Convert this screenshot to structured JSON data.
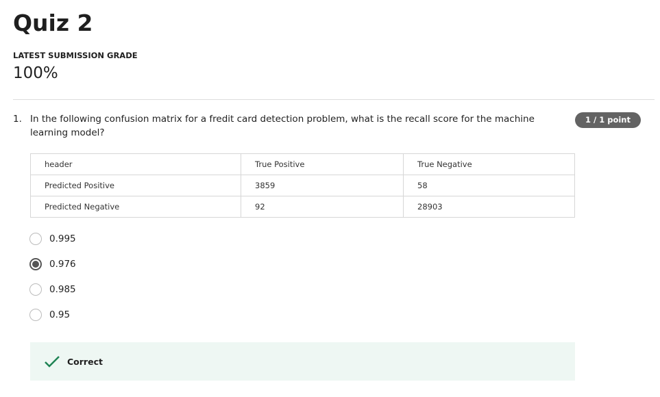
{
  "title": "Quiz 2",
  "grade_label": "LATEST SUBMISSION GRADE",
  "grade_value": "100%",
  "question": {
    "number": "1.",
    "text": "In the following confusion matrix for a fredit card detection problem, what is the recall score for the machine learning model?",
    "points": "1 / 1 point",
    "table": [
      [
        "header",
        "True Positive",
        "True Negative"
      ],
      [
        "Predicted Positive",
        "3859",
        "58"
      ],
      [
        "Predicted Negative",
        "92",
        "28903"
      ]
    ],
    "options": [
      {
        "label": "0.995",
        "selected": false
      },
      {
        "label": "0.976",
        "selected": true
      },
      {
        "label": "0.985",
        "selected": false
      },
      {
        "label": "0.95",
        "selected": false
      }
    ],
    "feedback": "Correct",
    "feedback_color": "#1f8354"
  }
}
